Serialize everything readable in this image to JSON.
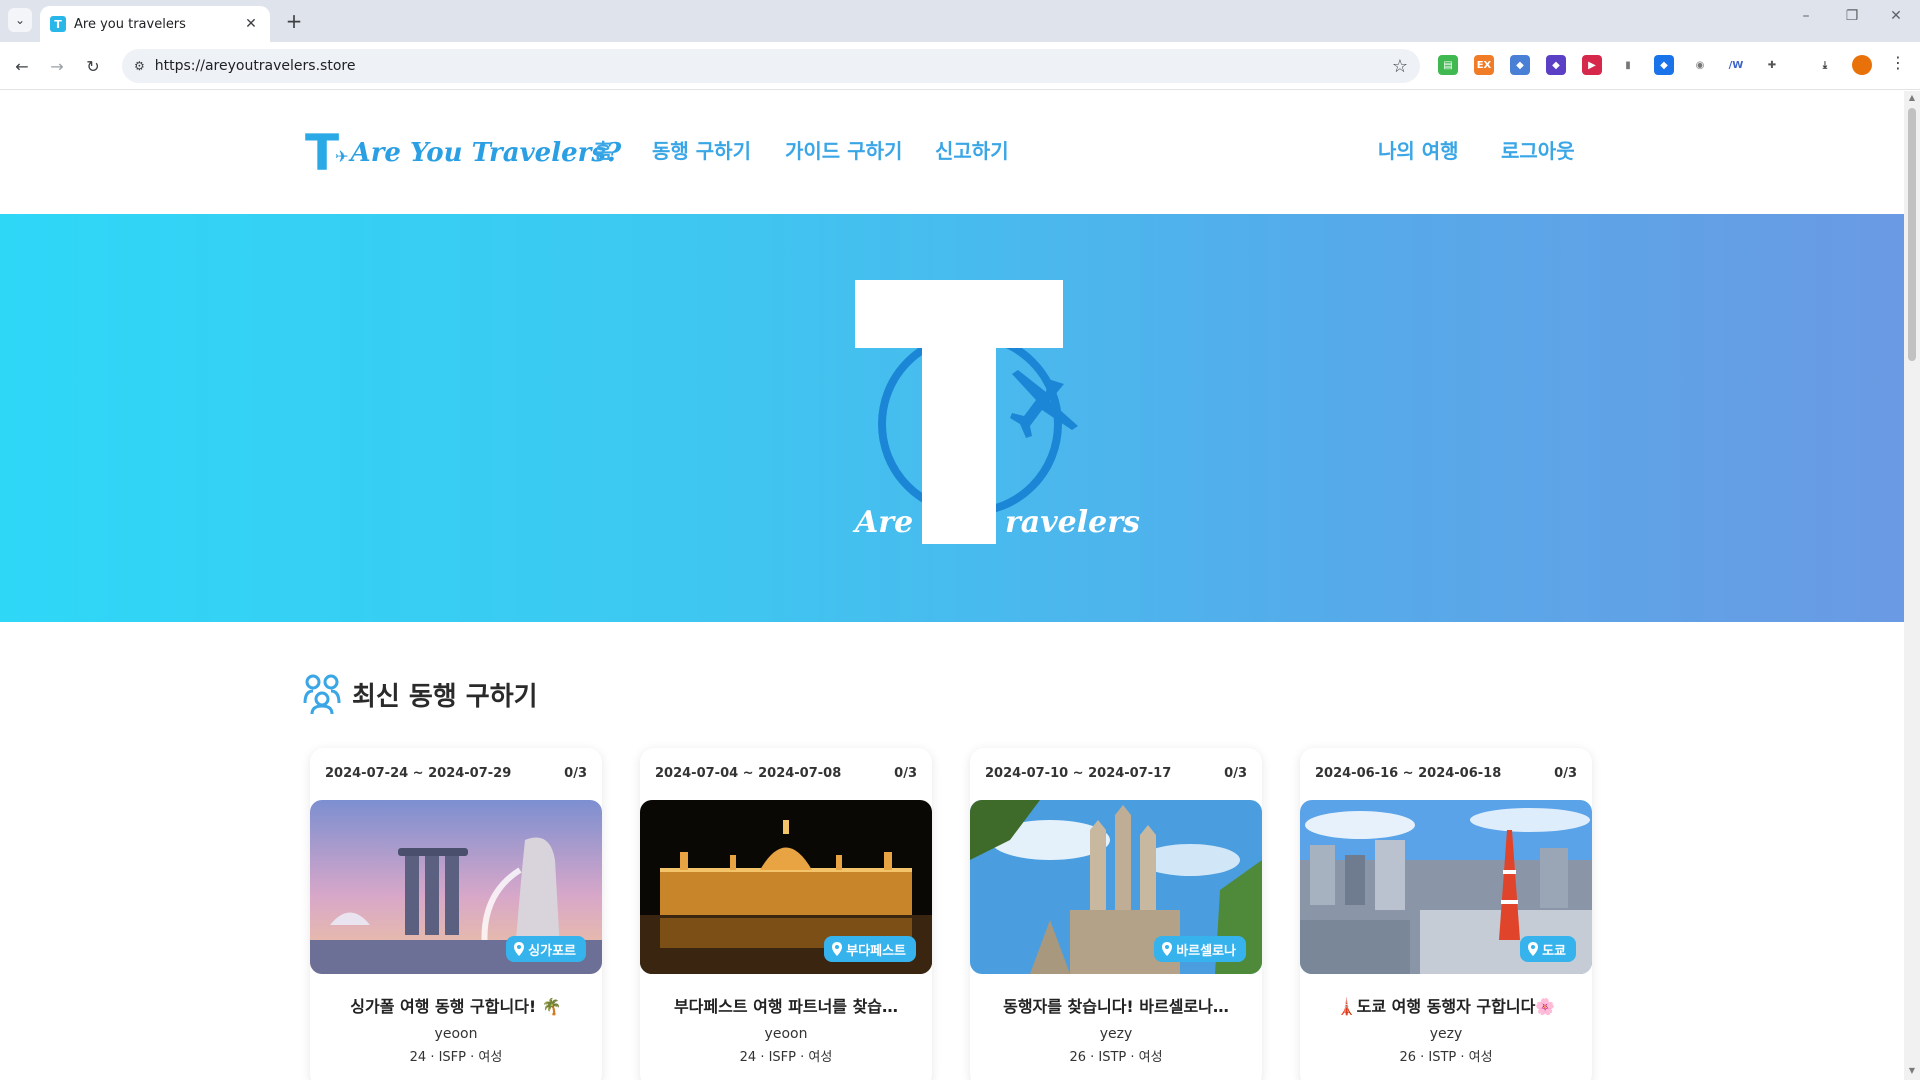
{
  "browser": {
    "tab_title": "Are you travelers",
    "tab_favicon": "T",
    "url": "https://areyoutravelers.store"
  },
  "site": {
    "logo_letter": "T",
    "logo_text": "Are You Travelers?",
    "nav": [
      "홈",
      "동행 구하기",
      "가이드 구하기",
      "신고하기"
    ],
    "nav_right": [
      "나의 여행",
      "로그아웃"
    ],
    "hero_tagline_left": "Are you",
    "hero_tagline_right": "ravelers?",
    "hero_letter": "T"
  },
  "section": {
    "title": "최신 동행 구하기",
    "icon": "group-icon"
  },
  "cards": [
    {
      "dates": "2024-07-24 ~ 2024-07-29",
      "count": "0/3",
      "location": "싱가포르",
      "title": "싱가폴 여행 동행 구합니다! 🌴",
      "user": "yeoon",
      "meta": "24 · ISFP · 여성",
      "image": "singapore-marina-bay"
    },
    {
      "dates": "2024-07-04 ~ 2024-07-08",
      "count": "0/3",
      "location": "부다페스트",
      "title": "부다페스트 여행 파트너를 찾습…",
      "user": "yeoon",
      "meta": "24 · ISFP · 여성",
      "image": "budapest-parliament-night"
    },
    {
      "dates": "2024-07-10 ~ 2024-07-17",
      "count": "0/3",
      "location": "바르셀로나",
      "title": "동행자를 찾습니다! 바르셀로나…",
      "user": "yezy",
      "meta": "26 · ISTP · 여성",
      "image": "barcelona-sagrada-familia"
    },
    {
      "dates": "2024-06-16 ~ 2024-06-18",
      "count": "0/3",
      "location": "도쿄",
      "title": "🗼도쿄 여행 동행자 구합니다🌸",
      "user": "yezy",
      "meta": "26 · ISTP · 여성",
      "image": "tokyo-tower-skyline"
    }
  ],
  "colors": {
    "brand": "#3aa6e6",
    "badge": "#36b3ec",
    "hero_start": "#2fd7f7",
    "hero_end": "#6a9ae3"
  }
}
